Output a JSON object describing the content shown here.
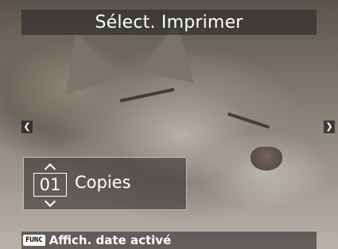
{
  "screen": {
    "title": "Sélect. Imprimer"
  },
  "navigation": {
    "prev_icon": "chevron-left-icon",
    "next_icon": "chevron-right-icon"
  },
  "copies": {
    "value": "01",
    "label": "Copies",
    "up_icon": "chevron-up-icon",
    "down_icon": "chevron-down-icon"
  },
  "footer": {
    "func_badge": "FUNC",
    "hint": "Affich. date activé"
  },
  "colors": {
    "overlay": "#282828",
    "text": "#ffffff"
  }
}
